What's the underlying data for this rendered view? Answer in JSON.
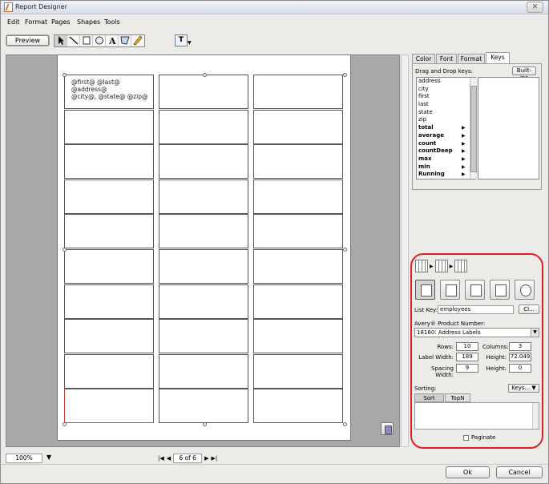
{
  "window": {
    "title": "Report Designer",
    "close_glyph": "✕"
  },
  "menu": [
    "Edit",
    "Format",
    "Pages",
    "Shapes",
    "Tools"
  ],
  "toolbar": {
    "preview_label": "Preview",
    "tools": [
      "select-arrow-icon",
      "line-icon",
      "rectangle-icon",
      "ellipse-icon",
      "text-A-icon",
      "polygon-icon",
      "pencil-icon"
    ],
    "text_tool_glyph": "T"
  },
  "label_template": {
    "line1": "@first@ @last@",
    "line2": "@address@",
    "line3": "@city@, @state@ @zip@"
  },
  "grid": {
    "rows": 10,
    "columns": 3
  },
  "status": {
    "zoom": "100%",
    "page": "6 of 6"
  },
  "tabs": [
    "Color",
    "Font",
    "Format",
    "Keys"
  ],
  "active_tab": "Keys",
  "keys_panel": {
    "title": "Drag and Drop keys:",
    "builtins_label": "Built-ins",
    "keys": [
      {
        "label": "address",
        "bold": false
      },
      {
        "label": "city",
        "bold": false
      },
      {
        "label": "first",
        "bold": false
      },
      {
        "label": "last",
        "bold": false
      },
      {
        "label": "state",
        "bold": false
      },
      {
        "label": "zip",
        "bold": false
      },
      {
        "label": "total",
        "bold": true
      },
      {
        "label": "average",
        "bold": true
      },
      {
        "label": "count",
        "bold": true
      },
      {
        "label": "countDeep",
        "bold": true
      },
      {
        "label": "max",
        "bold": true
      },
      {
        "label": "min",
        "bold": true
      },
      {
        "label": "Running",
        "bold": true
      }
    ]
  },
  "labels_panel": {
    "list_key_label": "List Key:",
    "list_key_value": "employees",
    "cl_button": "Cl...",
    "avery_label": "Avery® Product Number:",
    "avery_value": "18160: Address Labels",
    "rows_label": "Rows:",
    "rows_value": "10",
    "columns_label": "Columns:",
    "columns_value": "3",
    "label_width_label": "Label Width:",
    "label_width_value": "189",
    "height_label": "Height:",
    "height_value": "72.049",
    "spacing_width_label": "Spacing Width:",
    "spacing_width_value": "9",
    "spacing_height_label": "Height:",
    "spacing_height_value": "0",
    "sorting_label": "Sorting:",
    "keys_button": "Keys... ▼",
    "sort_tab": "Sort",
    "topn_tab": "TopN",
    "paginate_label": "Paginate"
  },
  "dialog": {
    "ok_label": "Ok",
    "cancel_label": "Cancel"
  }
}
